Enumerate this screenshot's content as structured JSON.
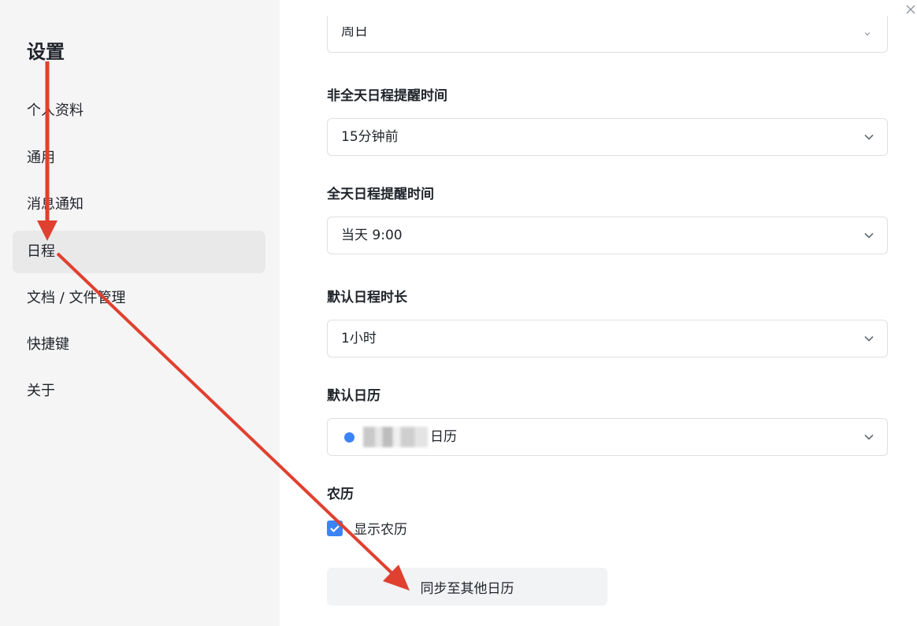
{
  "sidebar": {
    "title": "设置",
    "items": [
      {
        "label": "个人资料"
      },
      {
        "label": "通用"
      },
      {
        "label": "消息通知"
      },
      {
        "label": "日程",
        "active": true
      },
      {
        "label": "文档 / 文件管理"
      },
      {
        "label": "快捷键"
      },
      {
        "label": "关于"
      }
    ]
  },
  "main": {
    "week_start": {
      "value": "周日"
    },
    "non_allday_reminder": {
      "label": "非全天日程提醒时间",
      "value": "15分钟前"
    },
    "allday_reminder": {
      "label": "全天日程提醒时间",
      "value": "当天 9:00"
    },
    "default_duration": {
      "label": "默认日程时长",
      "value": "1小时"
    },
    "default_calendar": {
      "label": "默认日历",
      "value_suffix": "日历",
      "dot_color": "#3c83f6"
    },
    "lunar": {
      "label": "农历",
      "checkbox_label": "显示农历",
      "checked": true
    },
    "sync_button": "同步至其他日历"
  },
  "icons": {
    "close": "close-icon",
    "chevron": "chevron-down-icon",
    "check": "check-icon"
  },
  "colors": {
    "accent": "#3c83f6",
    "annotation_arrow": "#e0402f"
  }
}
